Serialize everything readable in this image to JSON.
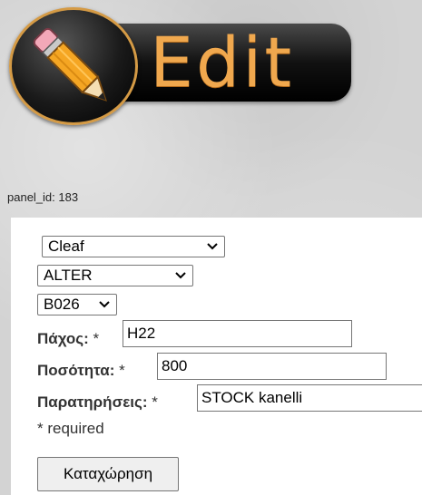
{
  "logo": {
    "text": "Edit",
    "icon": "pencil-icon"
  },
  "panel_id_label": "panel_id: 183",
  "selects": {
    "type": "Cleaf",
    "variant": "ALTER",
    "code": "B026"
  },
  "fields": {
    "thickness": {
      "label": "Πάχος:",
      "required_mark": "*",
      "value": "H22"
    },
    "quantity": {
      "label": "Ποσότητα:",
      "required_mark": "*",
      "value": "800"
    },
    "notes": {
      "label": "Παρατηρήσεις:",
      "required_mark": "*",
      "value": "STOCK kanelli"
    }
  },
  "required_note": "* required",
  "submit_label": "Καταχώρηση",
  "colors": {
    "logo_text": "#f0a84e",
    "logo_border": "#d49a45"
  }
}
